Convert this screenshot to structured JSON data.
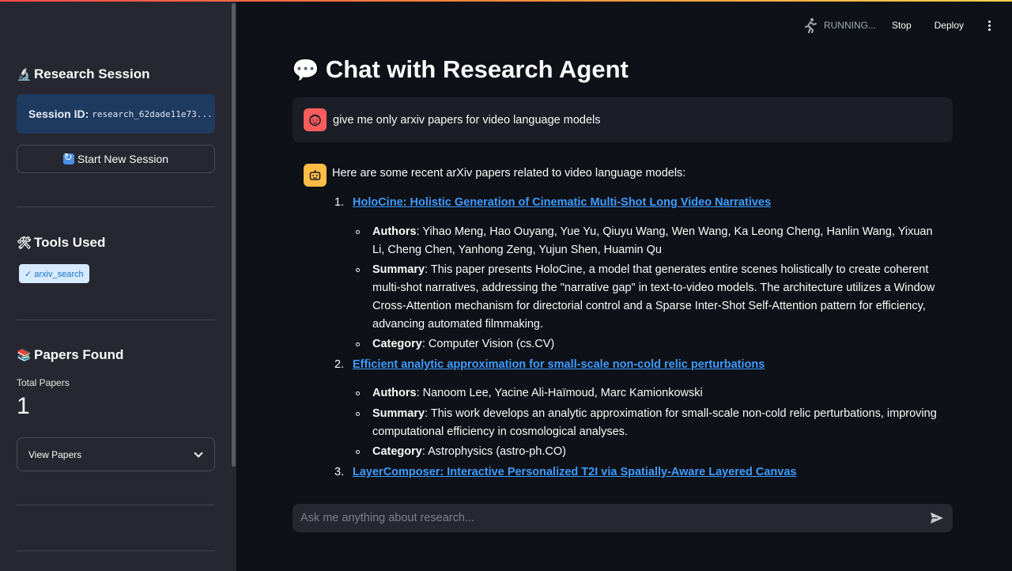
{
  "sidebar": {
    "research_session": {
      "emoji": "🔬",
      "title": "Research Session"
    },
    "session": {
      "label": "Session ID:",
      "value": "research_62dade11e73..."
    },
    "new_session_button": "Start New Session",
    "tools_used": {
      "emoji": "🛠",
      "title": "Tools Used",
      "tools": [
        "✓ arxiv_search"
      ]
    },
    "papers_found": {
      "emoji": "📚",
      "title": "Papers Found",
      "metric_label": "Total Papers",
      "metric_value": "1",
      "expander_label": "View Papers"
    }
  },
  "header": {
    "status": "RUNNING...",
    "stop_label": "Stop",
    "deploy_label": "Deploy"
  },
  "main": {
    "title_emoji": "💬",
    "title": "Chat with Research Agent",
    "user_message": "give me only arxiv papers for video language models",
    "assistant": {
      "intro": "Here are some recent arXiv papers related to video language models:",
      "papers": [
        {
          "num": "1.",
          "title": "HoloCine: Holistic Generation of Cinematic Multi-Shot Long Video Narratives",
          "authors_label": "Authors",
          "authors": ": Yihao Meng, Hao Ouyang, Yue Yu, Qiuyu Wang, Wen Wang, Ka Leong Cheng, Hanlin Wang, Yixuan Li, Cheng Chen, Yanhong Zeng, Yujun Shen, Huamin Qu",
          "summary_label": "Summary",
          "summary": ": This paper presents HoloCine, a model that generates entire scenes holistically to create coherent multi-shot narratives, addressing the \"narrative gap\" in text-to-video models. The architecture utilizes a Window Cross-Attention mechanism for directorial control and a Sparse Inter-Shot Self-Attention pattern for efficiency, advancing automated filmmaking.",
          "category_label": "Category",
          "category": ": Computer Vision (cs.CV)"
        },
        {
          "num": "2.",
          "title": "Efficient analytic approximation for small-scale non-cold relic perturbations",
          "authors_label": "Authors",
          "authors": ": Nanoom Lee, Yacine Ali-Haïmoud, Marc Kamionkowski",
          "summary_label": "Summary",
          "summary": ": This work develops an analytic approximation for small-scale non-cold relic perturbations, improving computational efficiency in cosmological analyses.",
          "category_label": "Category",
          "category": ": Astrophysics (astro-ph.CO)"
        },
        {
          "num": "3.",
          "title": "LayerComposer: Interactive Personalized T2I via Spatially-Aware Layered Canvas"
        }
      ]
    },
    "chat_input": {
      "placeholder": "Ask me anything about research..."
    }
  },
  "colors": {
    "background": "#0e1117",
    "sidebar": "#262730",
    "link": "#3d9bff",
    "user_avatar": "#ff5c5c",
    "bot_avatar": "#ffbd45",
    "session_box": "#1f3a5f"
  }
}
